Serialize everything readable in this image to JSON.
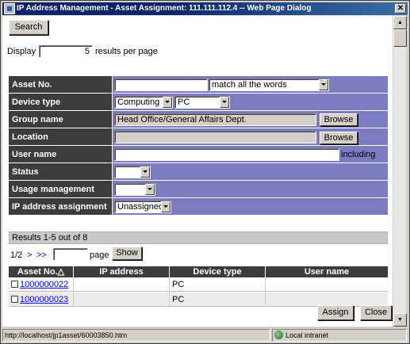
{
  "window": {
    "title": "IP Address Management - Asset Assignment: 111.111.112.4 -- Web Page Dialog",
    "close": "✕"
  },
  "toolbar": {
    "search_label": "Search"
  },
  "display": {
    "label_before": "Display",
    "value": "5",
    "label_after": "results per page"
  },
  "form": {
    "asset_no": {
      "label": "Asset No.",
      "value": "",
      "match_option": "match all the words"
    },
    "device_type": {
      "label": "Device type",
      "category": "Computing",
      "type": "PC"
    },
    "group_name": {
      "label": "Group name",
      "value": "Head Office/General Affairs Dept.",
      "browse": "Browse"
    },
    "location": {
      "label": "Location",
      "value": "",
      "browse": "Browse"
    },
    "user_name": {
      "label": "User name",
      "value": "",
      "suffix": "including"
    },
    "status": {
      "label": "Status",
      "value": ""
    },
    "usage_management": {
      "label": "Usage management",
      "value": ""
    },
    "ip_assignment": {
      "label": "IP address assignment",
      "value": "Unassigned"
    }
  },
  "results": {
    "summary": "Results 1-5 out of 8",
    "pager": {
      "page_info": "1/2",
      "next": ">",
      "last": ">>",
      "page_value": "",
      "page_label": "page",
      "show": "Show"
    },
    "columns": [
      "Asset No.△",
      "IP address",
      "Device type",
      "User name"
    ],
    "rows": [
      {
        "asset_no": "1000000022",
        "ip": "",
        "device": "PC",
        "user": ""
      },
      {
        "asset_no": "1000000023",
        "ip": "",
        "device": "PC",
        "user": ""
      }
    ]
  },
  "actions": {
    "assign": "Assign",
    "close": "Close"
  },
  "statusbar": {
    "url": "http://localhost/jp1asset/60003850.htm",
    "zone": "Local intranet"
  }
}
